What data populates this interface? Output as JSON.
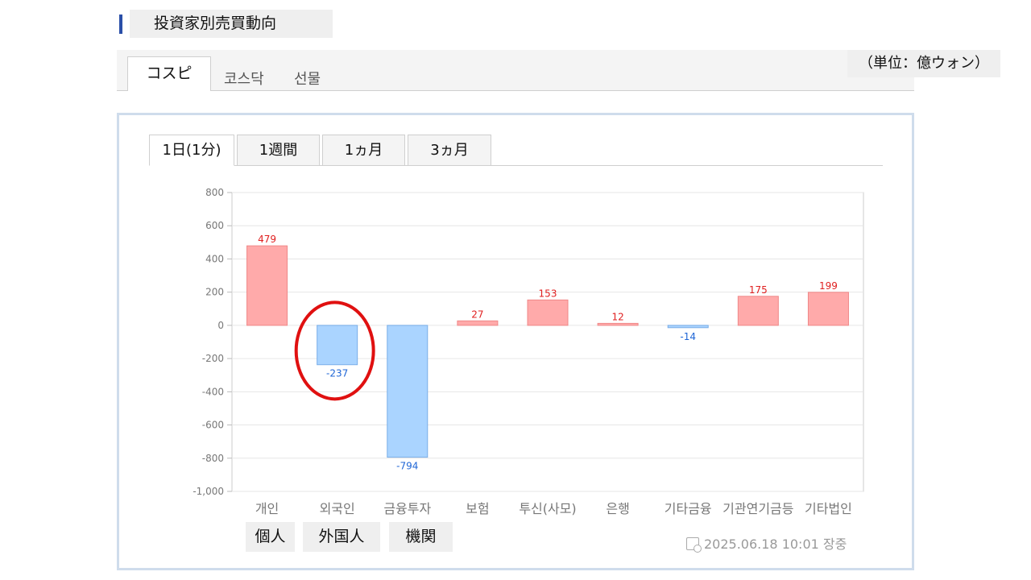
{
  "header": {
    "title": "投資家別売買動向"
  },
  "market_tabs": [
    {
      "label": "コスピ",
      "active": true
    },
    {
      "label": "코스닥",
      "active": false
    },
    {
      "label": "선물",
      "active": false
    }
  ],
  "unit_label": "（単位：億ウォン）",
  "period_tabs": [
    {
      "label": "1日(1分)",
      "active": true
    },
    {
      "label": "1週間",
      "active": false
    },
    {
      "label": "1ヵ月",
      "active": false
    },
    {
      "label": "3ヵ月",
      "active": false
    }
  ],
  "annotation_labels": [
    "個人",
    "外国人",
    "機関"
  ],
  "timestamp": "2025.06.18 10:01 장중",
  "colors": {
    "positive_fill": "#ffaaaa",
    "positive_stroke": "#f08888",
    "positive_text": "#e02020",
    "negative_fill": "#aad4ff",
    "negative_stroke": "#7aaee8",
    "negative_text": "#1f66d6",
    "highlight_circle": "#e01010"
  },
  "chart_data": {
    "type": "bar",
    "categories": [
      "개인",
      "외국인",
      "금융투자",
      "보험",
      "투신(사모)",
      "은행",
      "기타금융",
      "기관연기금등",
      "기타법인"
    ],
    "values": [
      479,
      -237,
      -794,
      27,
      153,
      12,
      -14,
      175,
      199
    ],
    "data_labels": [
      "479",
      "-237",
      "-794",
      "27",
      "153",
      "12",
      "-14",
      "175",
      "199"
    ],
    "ylim": [
      -1000,
      800
    ],
    "yticks": [
      800,
      600,
      400,
      200,
      0,
      -200,
      -400,
      -600,
      -800,
      -1000
    ],
    "ytick_labels": [
      "800",
      "600",
      "400",
      "200",
      "0",
      "-200",
      "-400",
      "-600",
      "-800",
      "-1,000"
    ],
    "grid": true,
    "highlighted_category": "외국인"
  }
}
